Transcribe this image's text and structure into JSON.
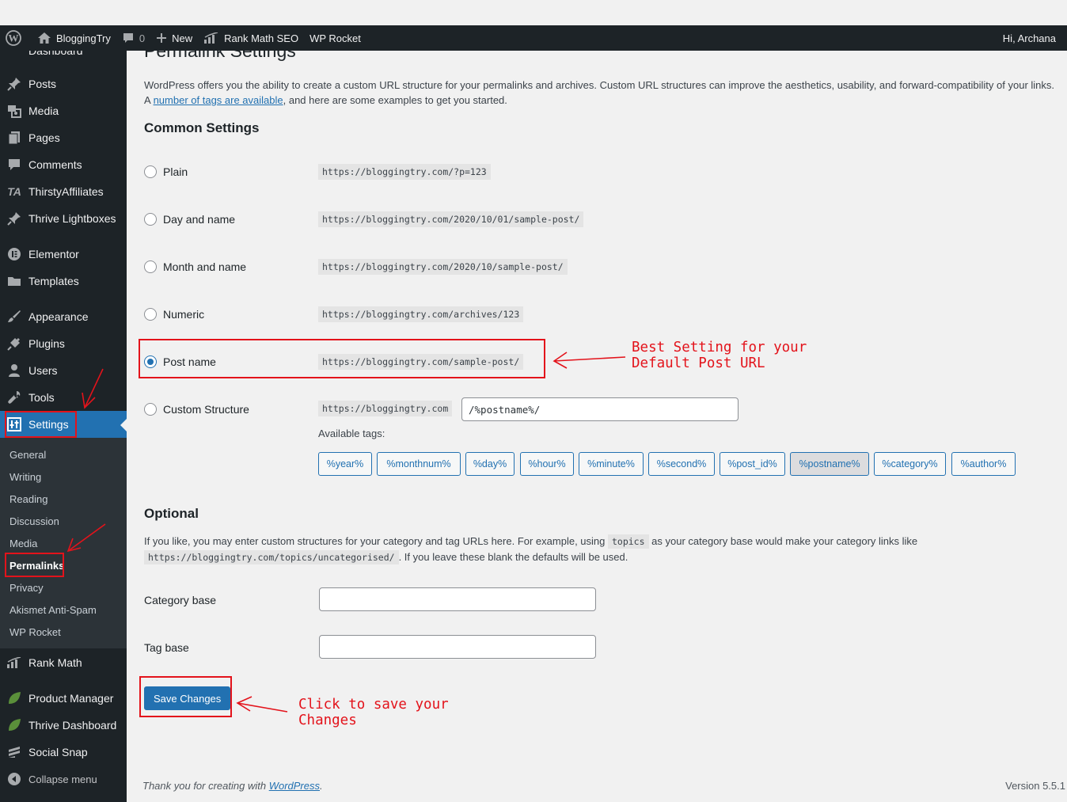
{
  "admin_bar": {
    "site_name": "BloggingTry",
    "comments_count": "0",
    "new_label": "New",
    "rank_math_label": "Rank Math SEO",
    "wp_rocket_label": "WP Rocket",
    "greeting": "Hi, Archana"
  },
  "sidebar": {
    "partial_item": "Dashboard",
    "items": [
      {
        "label": "Posts",
        "icon": "pin-icon"
      },
      {
        "label": "Media",
        "icon": "media-icon"
      },
      {
        "label": "Pages",
        "icon": "pages-icon"
      },
      {
        "label": "Comments",
        "icon": "comments-icon"
      },
      {
        "label": "ThirstyAffiliates",
        "icon": "thirstyaffiliates-icon"
      },
      {
        "label": "Thrive Lightboxes",
        "icon": "pin-icon"
      },
      {
        "label": "Elementor",
        "icon": "elementor-icon"
      },
      {
        "label": "Templates",
        "icon": "folder-icon"
      },
      {
        "label": "Appearance",
        "icon": "brush-icon"
      },
      {
        "label": "Plugins",
        "icon": "plug-icon"
      },
      {
        "label": "Users",
        "icon": "user-icon"
      },
      {
        "label": "Tools",
        "icon": "wrench-icon"
      },
      {
        "label": "Settings",
        "icon": "settings-icon"
      }
    ],
    "submenu": [
      "General",
      "Writing",
      "Reading",
      "Discussion",
      "Media",
      "Permalinks",
      "Privacy",
      "Akismet Anti-Spam",
      "WP Rocket"
    ],
    "bottom_items": [
      {
        "label": "Rank Math",
        "icon": "chart-icon"
      },
      {
        "label": "Product Manager",
        "icon": "leaf-icon"
      },
      {
        "label": "Thrive Dashboard",
        "icon": "leaf-icon"
      },
      {
        "label": "Social Snap",
        "icon": "social-snap-icon"
      },
      {
        "label": "Collapse menu",
        "icon": "collapse-icon"
      }
    ]
  },
  "page": {
    "title": "Permalink Settings",
    "intro_text": "WordPress offers you the ability to create a custom URL structure for your permalinks and archives. Custom URL structures can improve the aesthetics, usability, and forward-compatibility of your links. A ",
    "intro_link": "number of tags are available",
    "intro_text2": ", and here are some examples to get you started.",
    "common_heading": "Common Settings",
    "options": [
      {
        "label": "Plain",
        "example": "https://bloggingtry.com/?p=123",
        "checked": false
      },
      {
        "label": "Day and name",
        "example": "https://bloggingtry.com/2020/10/01/sample-post/",
        "checked": false
      },
      {
        "label": "Month and name",
        "example": "https://bloggingtry.com/2020/10/sample-post/",
        "checked": false
      },
      {
        "label": "Numeric",
        "example": "https://bloggingtry.com/archives/123",
        "checked": false
      },
      {
        "label": "Post name",
        "example": "https://bloggingtry.com/sample-post/",
        "checked": true
      },
      {
        "label": "Custom Structure",
        "example": "https://bloggingtry.com",
        "checked": false
      }
    ],
    "custom_structure_value": "/%postname%/",
    "available_tags_label": "Available tags:",
    "tags": [
      "%year%",
      "%monthnum%",
      "%day%",
      "%hour%",
      "%minute%",
      "%second%",
      "%post_id%",
      "%postname%",
      "%category%",
      "%author%"
    ],
    "active_tag": "%postname%",
    "optional_heading": "Optional",
    "optional_text1": "If you like, you may enter custom structures for your category and tag URLs here. For example, using ",
    "optional_code1": "topics",
    "optional_text2": " as your category base would make your category links like",
    "optional_code2": "https://bloggingtry.com/topics/uncategorised/",
    "optional_text3": ". If you leave these blank the defaults will be used.",
    "category_base_label": "Category base",
    "category_base_value": "",
    "tag_base_label": "Tag base",
    "tag_base_value": "",
    "save_label": "Save Changes"
  },
  "footer": {
    "thanks_text": "Thank you for creating with ",
    "thanks_link": "WordPress",
    "thanks_end": ".",
    "version": "Version 5.5.1"
  },
  "annotations": {
    "best_setting": "Best Setting for your\nDefault Post URL",
    "click_save": "Click to save your\nChanges",
    "color": "#e3131b"
  },
  "colors": {
    "admin_dark": "#1d2327",
    "accent": "#2271b1",
    "annotation_red": "#e3131b"
  }
}
